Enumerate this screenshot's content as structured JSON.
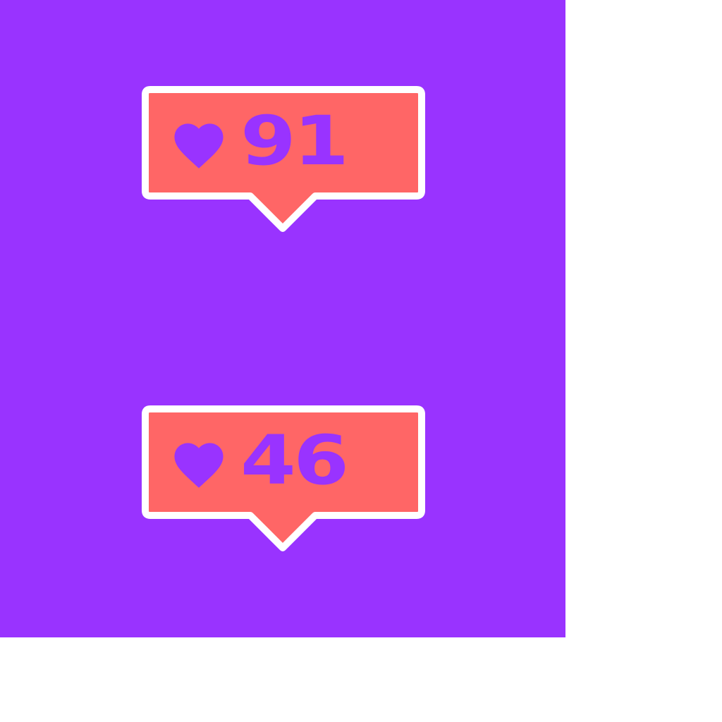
{
  "colors": {
    "background": "#9933ff",
    "bubble_fill": "#ff6666",
    "bubble_border": "#ffffff",
    "content": "#9933ff"
  },
  "notifications": [
    {
      "icon": "heart-icon",
      "count": "91"
    },
    {
      "icon": "heart-icon",
      "count": "46"
    }
  ]
}
